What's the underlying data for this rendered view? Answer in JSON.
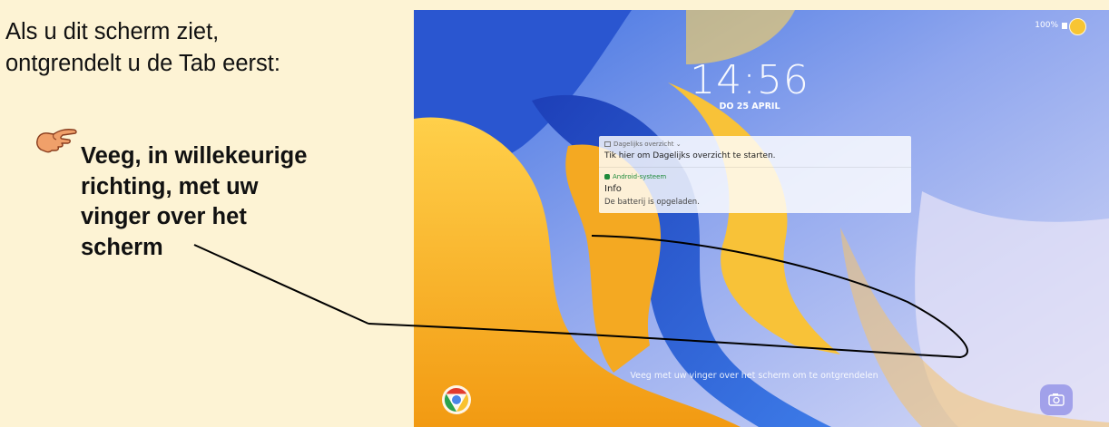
{
  "instructions": {
    "intro_lines": [
      "Als u dit scherm ziet,",
      "ontgrendelt u de Tab eerst:"
    ],
    "action_lines": [
      "Veeg, in willekeurige",
      "richting, met uw",
      "vinger over het",
      "scherm"
    ],
    "pointer_icon": "pointing-hand-icon"
  },
  "lockscreen": {
    "status": {
      "battery": "100%"
    },
    "time": "14:56",
    "date": "DO 25 APRIL",
    "notifications": [
      {
        "app": "Dagelijks overzicht",
        "title": "Tik hier om Dagelijks overzicht te starten."
      },
      {
        "app": "Android-systeem",
        "title": "Info",
        "text": "De batterij is opgeladen."
      }
    ],
    "unlock_hint": "Veeg met uw vinger over het scherm om te ontgrendelen",
    "shortcuts": {
      "left": "chrome-icon",
      "right": "camera-icon"
    }
  },
  "colors": {
    "panel_bg": "#fdf3d4",
    "hand": "#f0a06a",
    "wallpaper_yellow": "#f8b21c",
    "wallpaper_blue": "#2d63d8"
  }
}
